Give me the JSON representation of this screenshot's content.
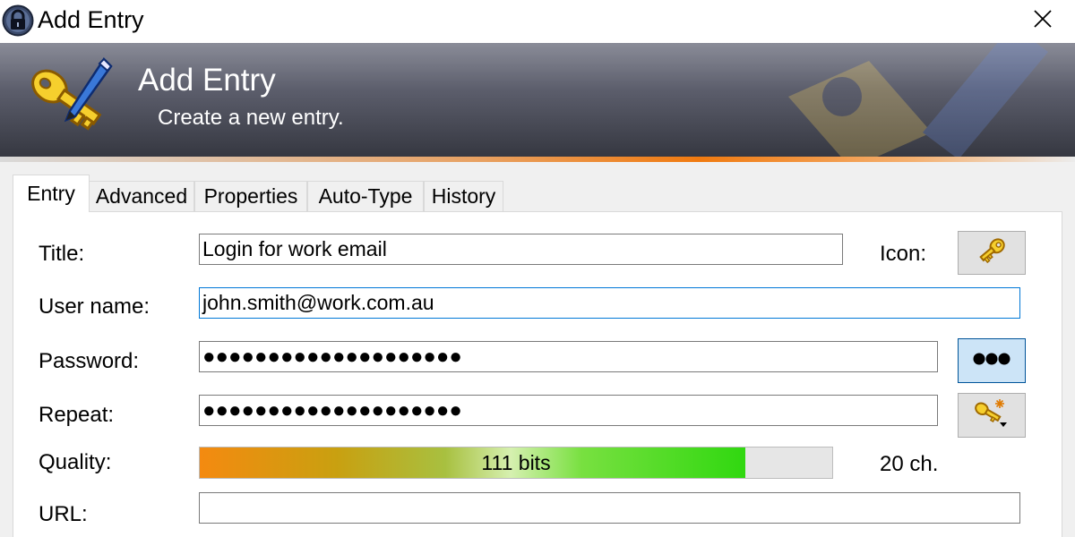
{
  "window": {
    "title": "Add Entry",
    "app_icon": "lock-icon",
    "close_icon": "close-icon"
  },
  "banner": {
    "title": "Add Entry",
    "subtitle": "Create a new entry.",
    "icon": "key-pencil-icon"
  },
  "tabs": [
    {
      "label": "Entry",
      "active": true
    },
    {
      "label": "Advanced",
      "active": false
    },
    {
      "label": "Properties",
      "active": false
    },
    {
      "label": "Auto-Type",
      "active": false
    },
    {
      "label": "History",
      "active": false
    }
  ],
  "form": {
    "title_label": "Title:",
    "title_value": "Login for work email",
    "icon_label": "Icon:",
    "icon_button": "key-icon",
    "username_label": "User name:",
    "username_value": "john.smith@work.com.au",
    "password_label": "Password:",
    "password_value": "●●●●●●●●●●●●●●●●●●●●",
    "password_toggle": "show-hide-password-icon",
    "repeat_label": "Repeat:",
    "repeat_value": "●●●●●●●●●●●●●●●●●●●●",
    "generator_button": "password-generator-icon",
    "quality_label": "Quality:",
    "quality_text": "111 bits",
    "quality_fraction": 0.862,
    "length_text": "20 ch.",
    "url_label": "URL:",
    "url_value": ""
  },
  "colors": {
    "banner_dark": "#34363f",
    "accent_orange": "#f07a10",
    "focus_blue": "#0078d7",
    "quality_green": "#30d810"
  }
}
